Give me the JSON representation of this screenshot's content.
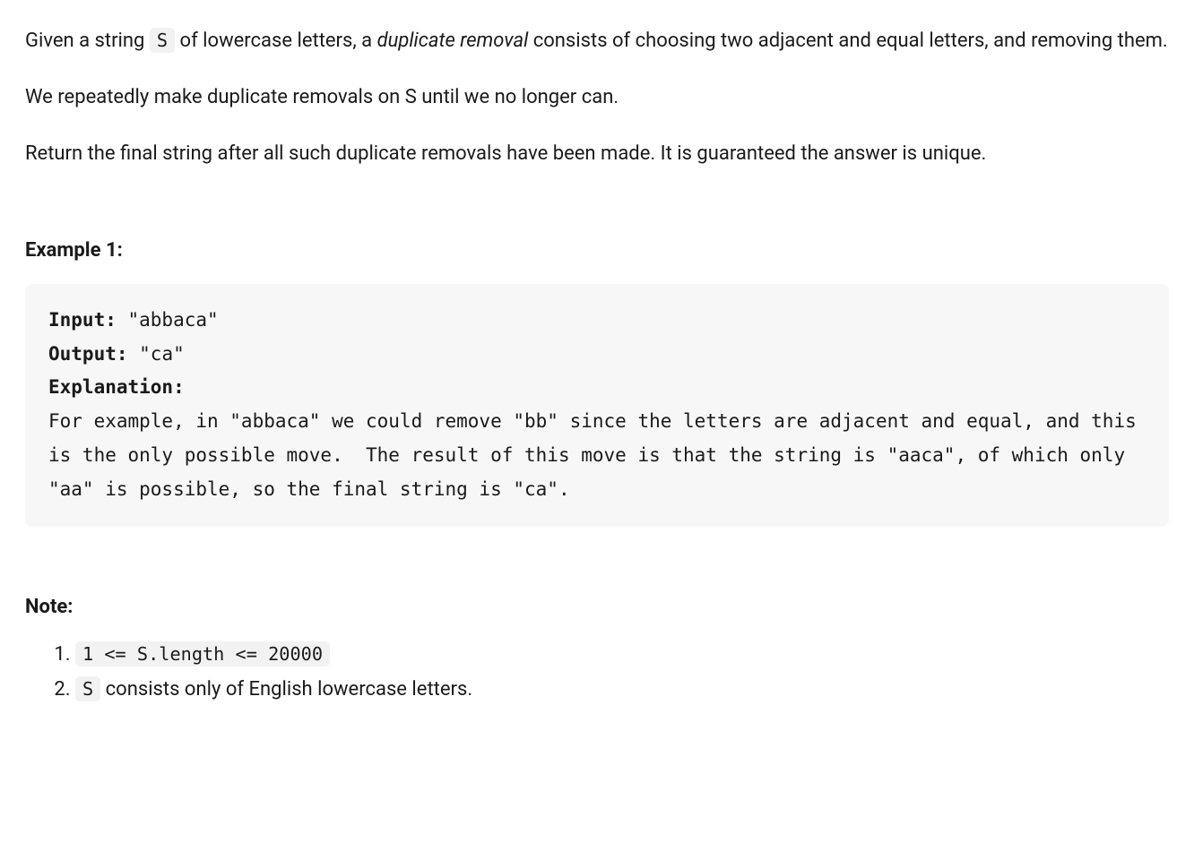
{
  "intro": {
    "p1_prefix": "Given a string ",
    "p1_code": "S",
    "p1_mid": " of lowercase letters, a ",
    "p1_em": "duplicate removal",
    "p1_suffix": " consists of choosing two adjacent and equal letters, and removing them.",
    "p2": "We repeatedly make duplicate removals on S until we no longer can.",
    "p3": "Return the final string after all such duplicate removals have been made.  It is guaranteed the answer is unique."
  },
  "example": {
    "heading": "Example 1:",
    "input_label": "Input:",
    "input_value": " \"abbaca\"",
    "output_label": "Output:",
    "output_value": " \"ca\"",
    "explanation_label": "Explanation:",
    "explanation_text": "For example, in \"abbaca\" we could remove \"bb\" since the letters are adjacent and equal, and this is the only possible move.  The result of this move is that the string is \"aaca\", of which only \"aa\" is possible, so the final string is \"ca\"."
  },
  "note": {
    "heading": "Note:",
    "item1_code": "1 <= S.length <= 20000",
    "item2_code": "S",
    "item2_suffix": " consists only of English lowercase letters."
  }
}
